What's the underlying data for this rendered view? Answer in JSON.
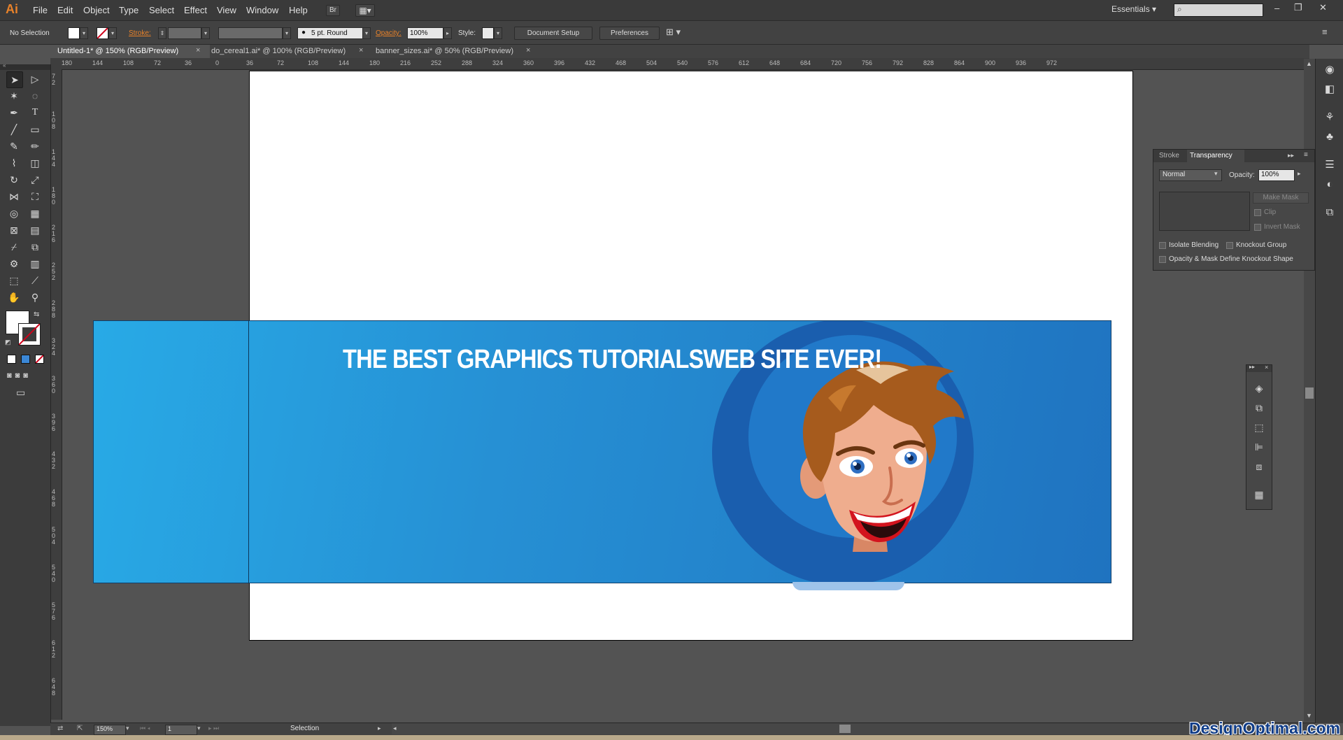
{
  "app": {
    "logo": "Ai",
    "window_buttons": [
      "–",
      "❐",
      "✕"
    ],
    "accent_color": "#e8822a"
  },
  "menu": {
    "items": [
      "File",
      "Edit",
      "Object",
      "Type",
      "Select",
      "Effect",
      "View",
      "Window",
      "Help"
    ],
    "bridge_label": "Br",
    "workspace": "Essentials",
    "search_placeholder": ""
  },
  "control_bar": {
    "selection_status": "No Selection",
    "stroke_label": "Stroke:",
    "brush_label": "5 pt. Round",
    "opacity_label": "Opacity:",
    "opacity_value": "100%",
    "style_label": "Style:",
    "document_setup_label": "Document Setup",
    "preferences_label": "Preferences"
  },
  "tabs": [
    {
      "label": "Untitled-1* @ 150% (RGB/Preview)",
      "active": true
    },
    {
      "label": "do_cereal1.ai* @ 100% (RGB/Preview)",
      "active": false
    },
    {
      "label": "banner_sizes.ai* @ 50% (RGB/Preview)",
      "active": false
    }
  ],
  "ruler": {
    "h_labels": [
      "180",
      "144",
      "108",
      "72",
      "36",
      "0",
      "36",
      "72",
      "108",
      "144",
      "180",
      "216",
      "252",
      "288",
      "324",
      "360",
      "396",
      "432",
      "468",
      "504",
      "540",
      "576",
      "612",
      "648",
      "684",
      "720",
      "756",
      "792",
      "828",
      "864",
      "900",
      "936",
      "972"
    ],
    "v_labels": [
      "72",
      "108",
      "144",
      "180",
      "216",
      "252",
      "288",
      "324",
      "360",
      "396",
      "432",
      "468",
      "504",
      "540",
      "576",
      "612",
      "648"
    ]
  },
  "canvas": {
    "headline": "THE BEST GRAPHICS TUTORIALSWEB SITE EVER!",
    "banner_colors": [
      "#28aae6",
      "#1f73c0"
    ]
  },
  "transparency_panel": {
    "tab_stroke": "Stroke",
    "tab_transparency": "Transparency",
    "blend_mode": "Normal",
    "opacity_label": "Opacity:",
    "opacity_value": "100%",
    "make_mask": "Make Mask",
    "clip": "Clip",
    "invert_mask": "Invert Mask",
    "isolate_blending": "Isolate Blending",
    "knockout_group": "Knockout Group",
    "opacity_mask_knockout": "Opacity & Mask Define Knockout Shape"
  },
  "status_bar": {
    "zoom": "150%",
    "artboard_number": "1",
    "tool_name": "Selection"
  },
  "watermark": "DesignOptimal.com"
}
